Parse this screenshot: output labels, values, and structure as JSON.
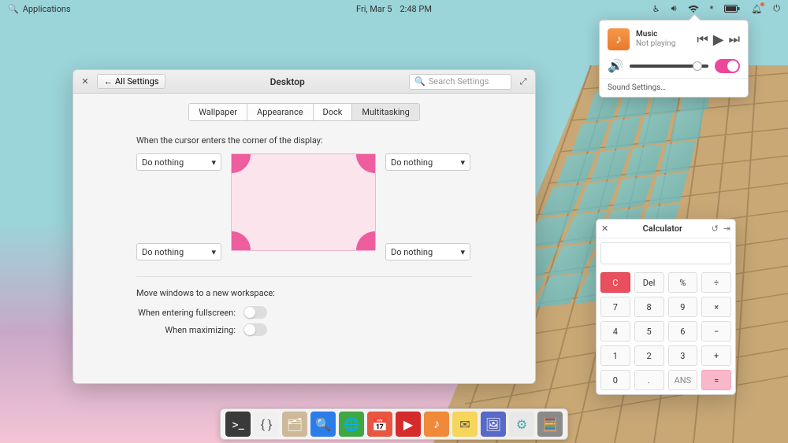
{
  "topbar": {
    "applications": "Applications",
    "date": "Fri, Mar  5",
    "time": "2:48 PM"
  },
  "settings": {
    "all_settings": "All Settings",
    "title": "Desktop",
    "search_placeholder": "Search Settings",
    "tabs": [
      "Wallpaper",
      "Appearance",
      "Dock",
      "Multitasking"
    ],
    "active_tab": 3,
    "corner_label": "When the cursor enters the corner of the display:",
    "dropdown_default": "Do nothing",
    "workspace_label": "Move windows to a new workspace:",
    "switch_fullscreen": "When entering fullscreen:",
    "switch_maximize": "When maximizing:"
  },
  "sound": {
    "media_title": "Music",
    "media_status": "Not playing",
    "settings_link": "Sound Settings…"
  },
  "calculator": {
    "title": "Calculator",
    "buttons": [
      "C",
      "Del",
      "%",
      "÷",
      "7",
      "8",
      "9",
      "×",
      "4",
      "5",
      "6",
      "−",
      "1",
      "2",
      "3",
      "+",
      "0",
      ".",
      "ANS",
      "="
    ]
  },
  "dock": {
    "items": [
      {
        "name": "terminal",
        "bg": "#3a3a3a",
        "glyph": ">_"
      },
      {
        "name": "code",
        "bg": "#f0f0f0",
        "glyph": "{ }",
        "fg": "#555"
      },
      {
        "name": "files",
        "bg": "#cdb99a",
        "glyph": "🗂"
      },
      {
        "name": "search",
        "bg": "#2b7de9",
        "glyph": "🔍"
      },
      {
        "name": "browser",
        "bg": "#3fa843",
        "glyph": "🌐"
      },
      {
        "name": "calendar",
        "bg": "#e85642",
        "glyph": "📅",
        "fg": "#fff"
      },
      {
        "name": "youtube",
        "bg": "#d52b2b",
        "glyph": "▶"
      },
      {
        "name": "music",
        "bg": "#f08a3a",
        "glyph": "♪"
      },
      {
        "name": "mail",
        "bg": "#f5d55a",
        "glyph": "✉",
        "fg": "#555"
      },
      {
        "name": "photos",
        "bg": "#5869c8",
        "glyph": "🖼"
      },
      {
        "name": "tweaks",
        "bg": "#e8e8e8",
        "glyph": "⚙",
        "fg": "#4aa"
      },
      {
        "name": "calculator",
        "bg": "#8a8a8a",
        "glyph": "🧮"
      }
    ]
  }
}
